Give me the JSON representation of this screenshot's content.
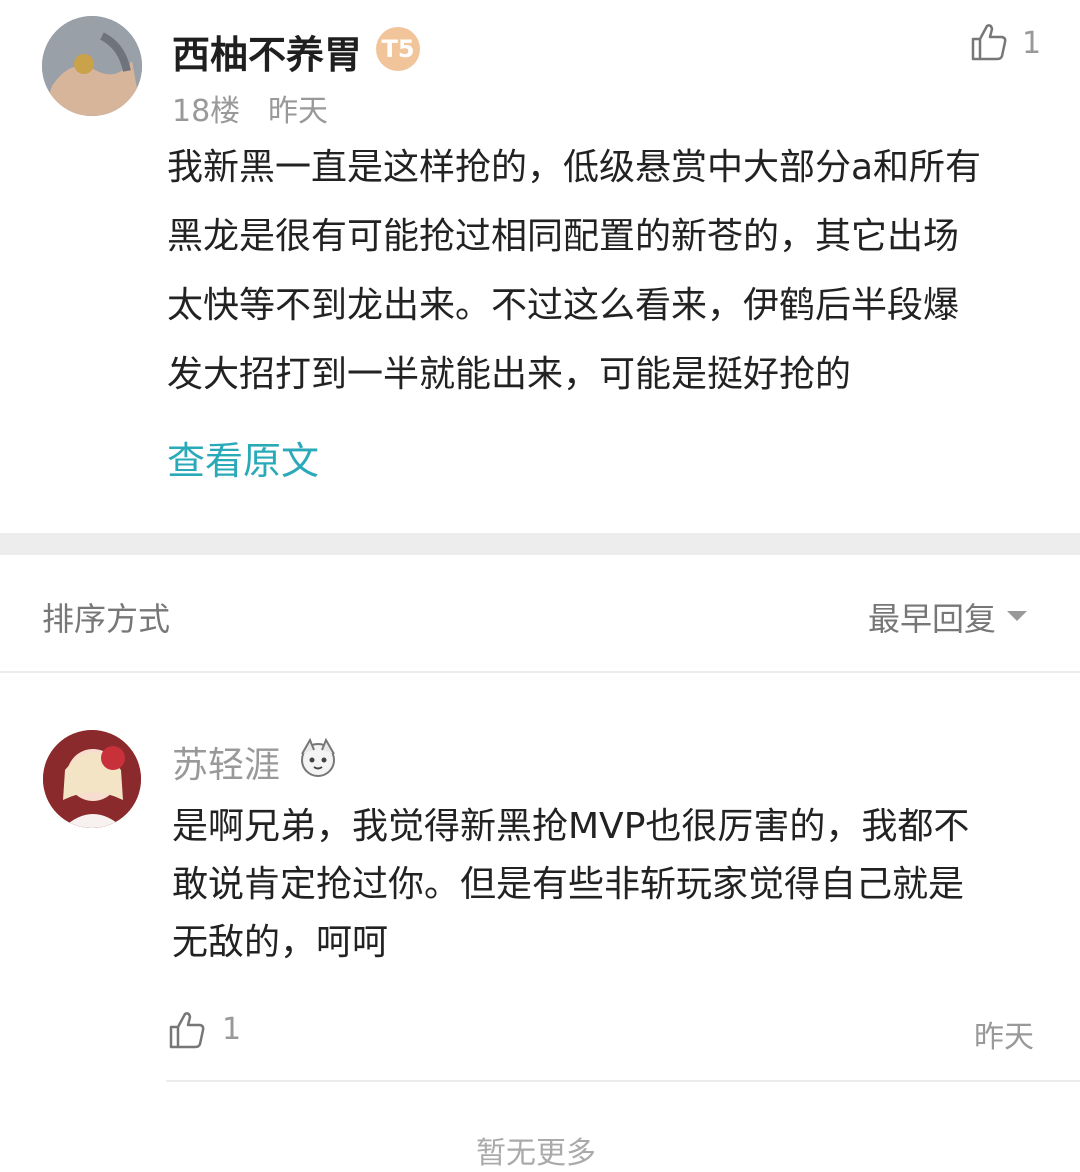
{
  "post": {
    "username": "西柚不养胃",
    "badge": "T5",
    "floor": "18楼",
    "time": "昨天",
    "likes": "1",
    "lines": [
      "我新黑一直是这样抢的，低级悬赏中大部分a和所有",
      "黑龙是很有可能抢过相同配置的新苍的，其它出场",
      "太快等不到龙出来。不过这么看来，伊鹤后半段爆",
      "发大招打到一半就能出来，可能是挺好抢的"
    ],
    "view_original": "查看原文"
  },
  "sort": {
    "label": "排序方式",
    "value": "最早回复"
  },
  "reply": {
    "username": "苏轻涯",
    "lines": [
      "是啊兄弟，我觉得新黑抢MVP也很厉害的，我都不",
      "敢说肯定抢过你。但是有些非斩玩家觉得自己就是",
      "无敌的，呵呵"
    ],
    "likes": "1",
    "time": "昨天"
  },
  "footer": {
    "no_more": "暂无更多"
  },
  "colors": {
    "accent": "#2aa9b8",
    "badge": "#f1c49a",
    "band": "#ededed"
  }
}
